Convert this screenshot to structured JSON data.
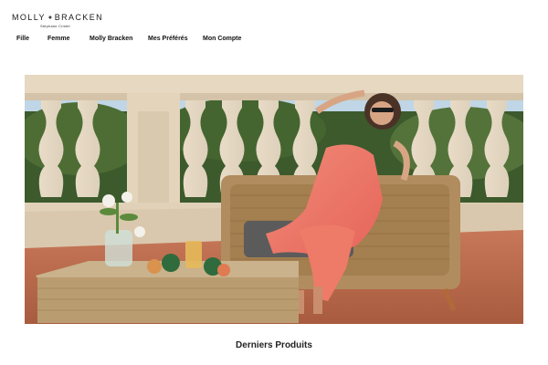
{
  "brand": {
    "name": "MOLLY BRACKEN",
    "name_left": "MOLLY",
    "name_right": "BRACKEN",
    "tagline": "Stéphane Cristel",
    "logo_icon": "flower-icon"
  },
  "nav": {
    "items": [
      {
        "label": "Fille"
      },
      {
        "label": "Femme"
      },
      {
        "label": "Molly Bracken"
      },
      {
        "label": "Mes Préférés"
      },
      {
        "label": "Mon Compte"
      }
    ]
  },
  "hero": {
    "content": "photo-woman-coral-dress-wicker-armchair-terrace"
  },
  "products": {
    "title": "Derniers Produits"
  }
}
